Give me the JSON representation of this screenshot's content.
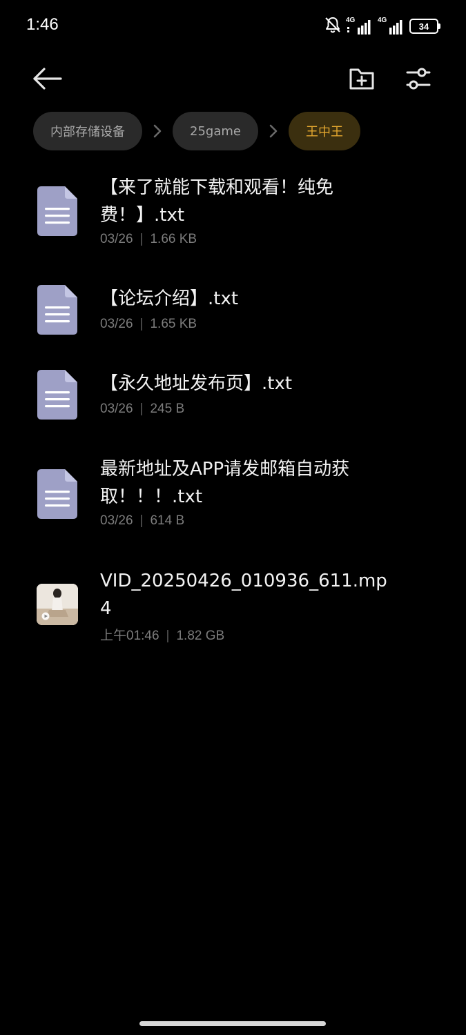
{
  "status": {
    "time": "1:46",
    "sim1_label": "4G",
    "sim2_label": "4G",
    "battery": "34"
  },
  "breadcrumb": [
    {
      "label": "内部存储设备"
    },
    {
      "label": "25game"
    },
    {
      "label": "王中王"
    }
  ],
  "files": [
    {
      "name": "【来了就能下载和观看！纯免费！】.txt",
      "date": "03/26",
      "size": "1.66 KB",
      "type": "document"
    },
    {
      "name": "【论坛介绍】.txt",
      "date": "03/26",
      "size": "1.65 KB",
      "type": "document"
    },
    {
      "name": "【永久地址发布页】.txt",
      "date": "03/26",
      "size": "245 B",
      "type": "document"
    },
    {
      "name": "最新地址及APP请发邮箱自动获取！！！.txt",
      "date": "03/26",
      "size": "614 B",
      "type": "document"
    },
    {
      "name": "VID_20250426_010936_611.mp4",
      "date": "上午01:46",
      "size": "1.82 GB",
      "type": "video"
    }
  ],
  "colors": {
    "accent": "#e3a72f",
    "doc_icon": "#9ea0c6",
    "background": "#000000"
  },
  "icons": {
    "back": "arrow-left-icon",
    "new_folder": "folder-plus-icon",
    "filter": "sliders-icon",
    "document": "document-icon",
    "mute": "bell-off-icon"
  }
}
